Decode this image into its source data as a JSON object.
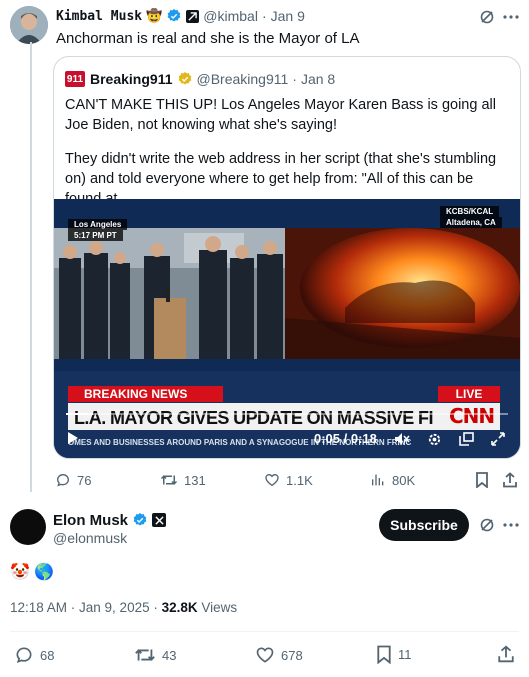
{
  "reply": {
    "name": "Kimbal Musk",
    "handle": "@kimbal",
    "date": "Jan 9",
    "text": "Anchorman is real and she is the Mayor of LA",
    "emoji": "🤠",
    "quote": {
      "logo_text": "911",
      "name": "Breaking911",
      "handle": "@Breaking911",
      "date": "Jan 8",
      "text1": "CAN'T MAKE THIS UP! Los Angeles Mayor Karen Bass is going all Joe Biden, not knowing what she's saying!",
      "text2": "They didn't write the web address in her script (that she's stumbling on) and told everyone where to get help from: \"All of this can be found at ...",
      "video": {
        "location_left": "Los Angeles",
        "time_left": "5:17 PM PT",
        "station": "KCBS/KCAL",
        "location_right": "Altadena, CA",
        "breaking": "BREAKING NEWS",
        "live": "LIVE",
        "headline": "L.A. MAYOR GIVES UPDATE ON MASSIVE FIRES",
        "ticker": "OMES AND BUSINESSES AROUND PARIS AND A SYNAGOGUE IN THE NORTHERN FRINC",
        "network": "CNN",
        "progress": 0.06,
        "time": "0:05 / 0:18"
      }
    },
    "stats": {
      "replies": "76",
      "reposts": "131",
      "likes": "1.1K",
      "views": "80K"
    }
  },
  "main": {
    "name": "Elon Musk",
    "handle": "@elonmusk",
    "subscribe_label": "Subscribe",
    "text": "🤡 🌎",
    "time": "12:18 AM · Jan 9, 2025 · ",
    "views_count": "32.8K",
    "views_label": " Views",
    "stats": {
      "replies": "68",
      "reposts": "43",
      "likes": "678",
      "bookmarks": "11"
    }
  },
  "colors": {
    "verified_blue": "#1d9bf0",
    "gold": "#e2b719",
    "text": "#0f1419",
    "muted": "#536471",
    "cnn_red": "#cc0000"
  }
}
